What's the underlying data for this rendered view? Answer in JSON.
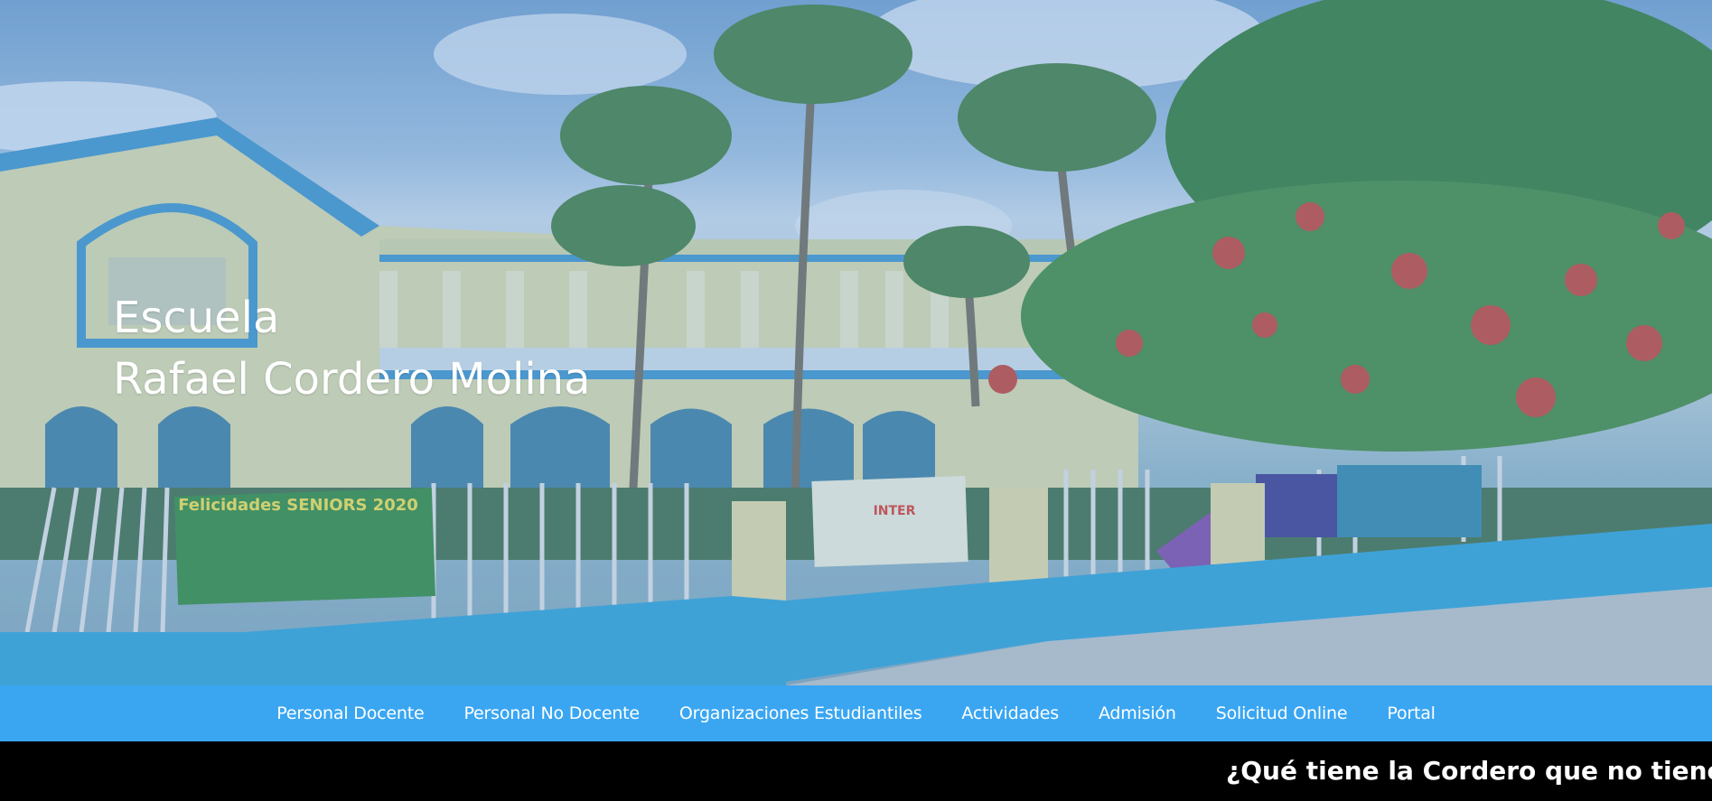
{
  "hero": {
    "title_line1": "Escuela",
    "title_line2": "Rafael Cordero Molina",
    "image": "school-building-photo",
    "banner_left": "Felicidades SENIORS 2020",
    "banner_center": "INTER"
  },
  "nav": {
    "items": [
      {
        "label": "Personal Docente"
      },
      {
        "label": "Personal No Docente"
      },
      {
        "label": "Organizaciones Estudiantiles"
      },
      {
        "label": "Actividades"
      },
      {
        "label": "Admisión"
      },
      {
        "label": "Solicitud Online"
      },
      {
        "label": "Portal"
      }
    ]
  },
  "ticker": {
    "text": "¿Qué tiene la Cordero que no tienen los"
  },
  "colors": {
    "nav_bg": "#3aa6f2",
    "ticker_bg": "#000000",
    "text": "#ffffff"
  }
}
